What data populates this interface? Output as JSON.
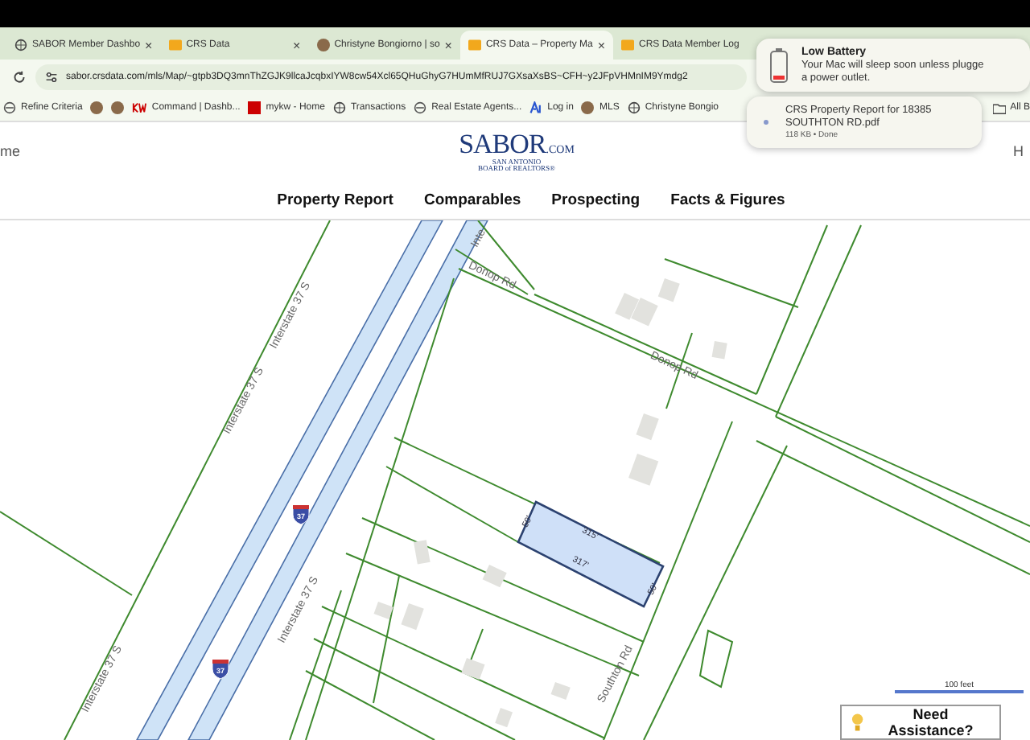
{
  "tabs": [
    {
      "label": "SABOR Member Dashbo",
      "close": "×",
      "selected": false
    },
    {
      "label": "CRS Data",
      "close": "×",
      "selected": false
    },
    {
      "label": "Christyne Bongiorno | so",
      "close": "×",
      "selected": false
    },
    {
      "label": "CRS Data – Property Ma",
      "close": "×",
      "selected": true
    },
    {
      "label": "CRS Data Member Log",
      "selected": false
    }
  ],
  "address_bar": {
    "url": "sabor.crsdata.com/mls/Map/~gtpb3DQ3mnThZGJK9llcaJcqbxIYW8cw54Xcl65QHuGhyG7HUmMfRUJ7GXsaXsBS~CFH~y2JFpVHMnIM9Ymdg2"
  },
  "bookmarks": [
    "Refine Criteria",
    "Command | Dashb...",
    "mykw - Home",
    "Transactions",
    "Real Estate Agents...",
    "Log in",
    "MLS",
    "Christyne Bongio",
    "All B"
  ],
  "notification": {
    "title": "Low Battery",
    "message": "Your Mac will sleep soon unless plugge",
    "message_2": "a power outlet."
  },
  "download": {
    "title": "CRS Property Report for 18385",
    "file": "SOUTHTON RD.pdf",
    "status": "118 KB • Done"
  },
  "header": {
    "left_text": "me",
    "right_text": "H",
    "logo": {
      "name": "SABOR",
      "suffix": ".COM",
      "line_1": "SAN ANTONIO",
      "line_2": "BOARD of REALTORS®"
    }
  },
  "nav": [
    "Property Report",
    "Comparables",
    "Prospecting",
    "Facts & Figures"
  ],
  "map": {
    "labels": [
      {
        "text": "Interstate 37 S",
        "kind": "highway"
      },
      {
        "text": "Interstate 37 S",
        "kind": "highway"
      },
      {
        "text": "Interstate 37 S",
        "kind": "highway"
      },
      {
        "text": "Interstate 37 S",
        "kind": "highway"
      },
      {
        "text": "Donop Rd",
        "kind": "street"
      },
      {
        "text": "Donop Rd",
        "kind": "street"
      },
      {
        "text": "Inte",
        "kind": "street"
      },
      {
        "text": "Southton Rd",
        "kind": "street"
      },
      {
        "text": "315'",
        "kind": "dimension"
      },
      {
        "text": "317'",
        "kind": "dimension"
      },
      {
        "text": "50'",
        "kind": "dimension"
      },
      {
        "text": "50'",
        "kind": "dimension"
      },
      {
        "text": "37",
        "kind": "shield"
      },
      {
        "text": "37",
        "kind": "shield"
      }
    ],
    "scale": "100 feet",
    "help_button": "Need Assistance?"
  }
}
